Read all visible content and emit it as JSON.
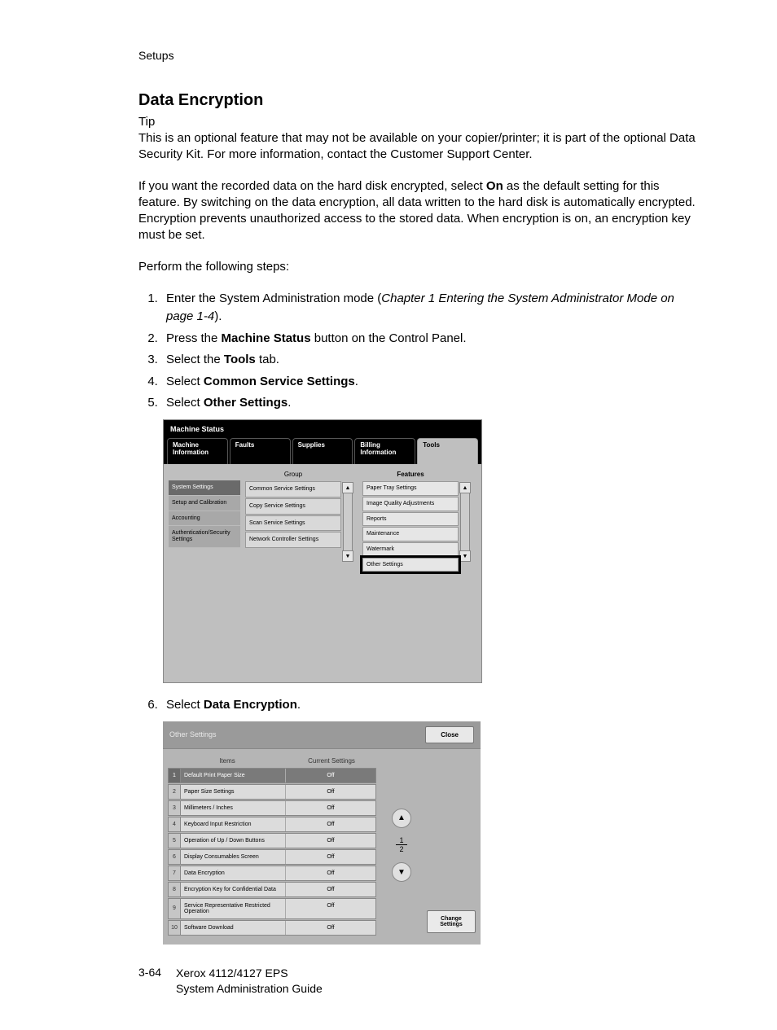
{
  "header": {
    "section": "Setups"
  },
  "title": "Data Encryption",
  "tip_label": "Tip",
  "tip_body": "This is an optional feature that may not be available on your copier/printer; it is part of the optional Data Security Kit.  For more information, contact the Customer Support Center.",
  "para2_a": "If you want the recorded data on the hard disk encrypted, select ",
  "para2_on": "On",
  "para2_b": " as the default setting for this feature.  By switching on the data encryption, all data written to the hard disk is automatically encrypted.  Encryption prevents unauthorized access to the stored data.  When encryption is on, an encryption key must be set.",
  "perform": "Perform the following steps:",
  "steps": {
    "s1a": "Enter the System Administration mode (",
    "s1b": "Chapter 1 Entering the System Administrator Mode on page 1-4",
    "s1c": ").",
    "s2a": "Press the ",
    "s2b": "Machine Status",
    "s2c": " button on the Control Panel.",
    "s3a": "Select the ",
    "s3b": "Tools",
    "s3c": " tab.",
    "s4a": "Select ",
    "s4b": "Common Service Settings",
    "s4c": ".",
    "s5a": "Select ",
    "s5b": "Other Settings",
    "s5c": ".",
    "s6a": "Select ",
    "s6b": "Data Encryption",
    "s6c": "."
  },
  "shot1": {
    "title": "Machine Status",
    "tabs": [
      "Machine Information",
      "Faults",
      "Supplies",
      "Billing Information",
      "Tools"
    ],
    "col_labels": {
      "group": "Group",
      "features": "Features"
    },
    "sidebar": [
      "System Settings",
      "Setup and Calibration",
      "Accounting",
      "Authentication/Security Settings"
    ],
    "group_items": [
      "Common Service Settings",
      "Copy Service Settings",
      "Scan Service Settings",
      "Network Controller Settings"
    ],
    "feature_items": [
      "Paper Tray Settings",
      "Image Quality Adjustments",
      "Reports",
      "Maintenance",
      "Watermark",
      "Other Settings"
    ]
  },
  "shot2": {
    "title": "Other Settings",
    "close": "Close",
    "head_items": "Items",
    "head_current": "Current Settings",
    "rows": [
      {
        "n": "1",
        "name": "Default Print Paper Size",
        "val": "Off"
      },
      {
        "n": "2",
        "name": "Paper Size Settings",
        "val": "Off"
      },
      {
        "n": "3",
        "name": "Millimeters / Inches",
        "val": "Off"
      },
      {
        "n": "4",
        "name": "Keyboard Input Restriction",
        "val": "Off"
      },
      {
        "n": "5",
        "name": "Operation of Up / Down Buttons",
        "val": "Off"
      },
      {
        "n": "6",
        "name": "Display Consumables Screen",
        "val": "Off"
      },
      {
        "n": "7",
        "name": "Data Encryption",
        "val": "Off"
      },
      {
        "n": "8",
        "name": "Encryption Key for Confidential Data",
        "val": "Off"
      },
      {
        "n": "9",
        "name": "Service Representative Restricted Operation",
        "val": "Off"
      },
      {
        "n": "10",
        "name": "Software Download",
        "val": "Off"
      }
    ],
    "page": {
      "p1": "1",
      "p2": "2"
    },
    "change": "Change Settings"
  },
  "footer": {
    "page": "3-64",
    "l1": "Xerox 4112/4127 EPS",
    "l2": "System Administration Guide"
  }
}
